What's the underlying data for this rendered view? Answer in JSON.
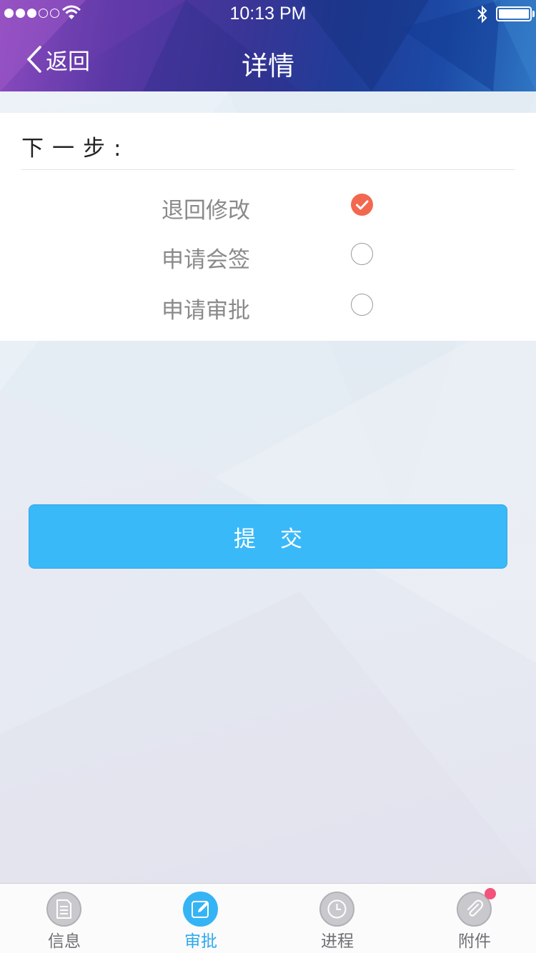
{
  "status_bar": {
    "time": "10:13 PM",
    "signal_dots_filled": 3,
    "signal_dots_total": 5,
    "icons": [
      "wifi-icon",
      "bluetooth-icon",
      "battery-icon"
    ],
    "battery_level": 1.0
  },
  "nav": {
    "back_label": "返回",
    "title": "详情"
  },
  "panel": {
    "step_label": "下一步:",
    "options": [
      {
        "label": "退回修改",
        "checked": true
      },
      {
        "label": "申请会签",
        "checked": false
      },
      {
        "label": "申请审批",
        "checked": false
      }
    ]
  },
  "submit_label": "提交",
  "tabs": [
    {
      "label": "信息",
      "icon": "document-icon",
      "active": false
    },
    {
      "label": "审批",
      "icon": "edit-icon",
      "active": true
    },
    {
      "label": "进程",
      "icon": "clock-icon",
      "active": false
    },
    {
      "label": "附件",
      "icon": "paperclip-icon",
      "active": false,
      "badge": true
    }
  ],
  "colors": {
    "accent": "#3ab9f9",
    "checked": "#f2684f",
    "badge": "#f4527a",
    "header_start": "#8d4bbf",
    "header_end": "#2f76c4"
  }
}
